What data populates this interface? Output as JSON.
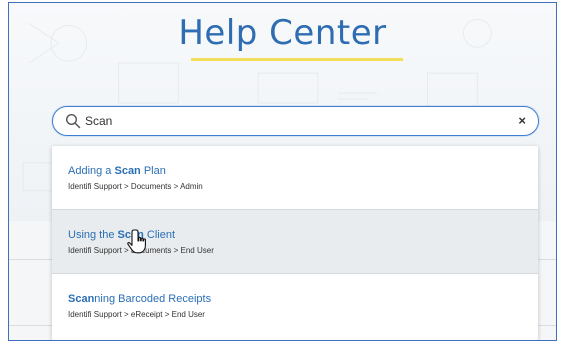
{
  "header": {
    "title": "Help Center"
  },
  "search": {
    "value": "Scan"
  },
  "results": [
    {
      "title_pre": "Adding a ",
      "title_match": "Scan",
      "title_post": " Plan",
      "path": "Identifi Support > Documents > Admin"
    },
    {
      "title_pre": "Using the ",
      "title_match": "Scan",
      "title_post": " Client",
      "path": "Identifi Support > Documents > End User"
    },
    {
      "title_pre": "",
      "title_match": "Scan",
      "title_post": "ning Barcoded Receipts",
      "path": "Identifi Support > eReceipt > End User"
    }
  ],
  "colors": {
    "accent": "#2f6db3",
    "underline": "#f1df5b",
    "hover_row": "#e9ecee"
  },
  "icons": {
    "search": "search-icon",
    "clear": "close-icon",
    "cursor": "hand-pointer-icon"
  }
}
